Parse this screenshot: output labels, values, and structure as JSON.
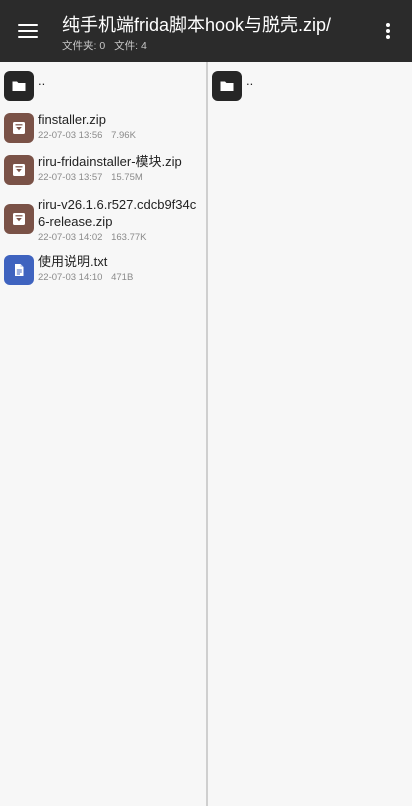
{
  "appbar": {
    "title": "纯手机端frida脚本hook与脱壳.zip/",
    "folders": "文件夹: 0",
    "files": "文件: 4"
  },
  "left_pane": {
    "parent_label": "..",
    "items": [
      {
        "name_lines": [
          "finstaller.zip"
        ],
        "date": "22-07-03 13:56",
        "size": "7.96K",
        "type": "archive"
      },
      {
        "name_lines": [
          "riru-fridainstaller-模块.zip"
        ],
        "date": "22-07-03 13:57",
        "size": "15.75M",
        "type": "archive"
      },
      {
        "name_lines": [
          "riru-v26.1.6.r527.cdcb9f34c",
          "6-release.zip"
        ],
        "date": "22-07-03 14:02",
        "size": "163.77K",
        "type": "archive"
      },
      {
        "name_lines": [
          "使用说明.txt"
        ],
        "date": "22-07-03 14:10",
        "size": "471B",
        "type": "text"
      }
    ]
  },
  "right_pane": {
    "parent_label": ".."
  },
  "colors": {
    "appbar": "#2b2b2b",
    "folder_icon": "#262626",
    "archive_icon": "#7a5247",
    "text_icon": "#3f63bf"
  }
}
